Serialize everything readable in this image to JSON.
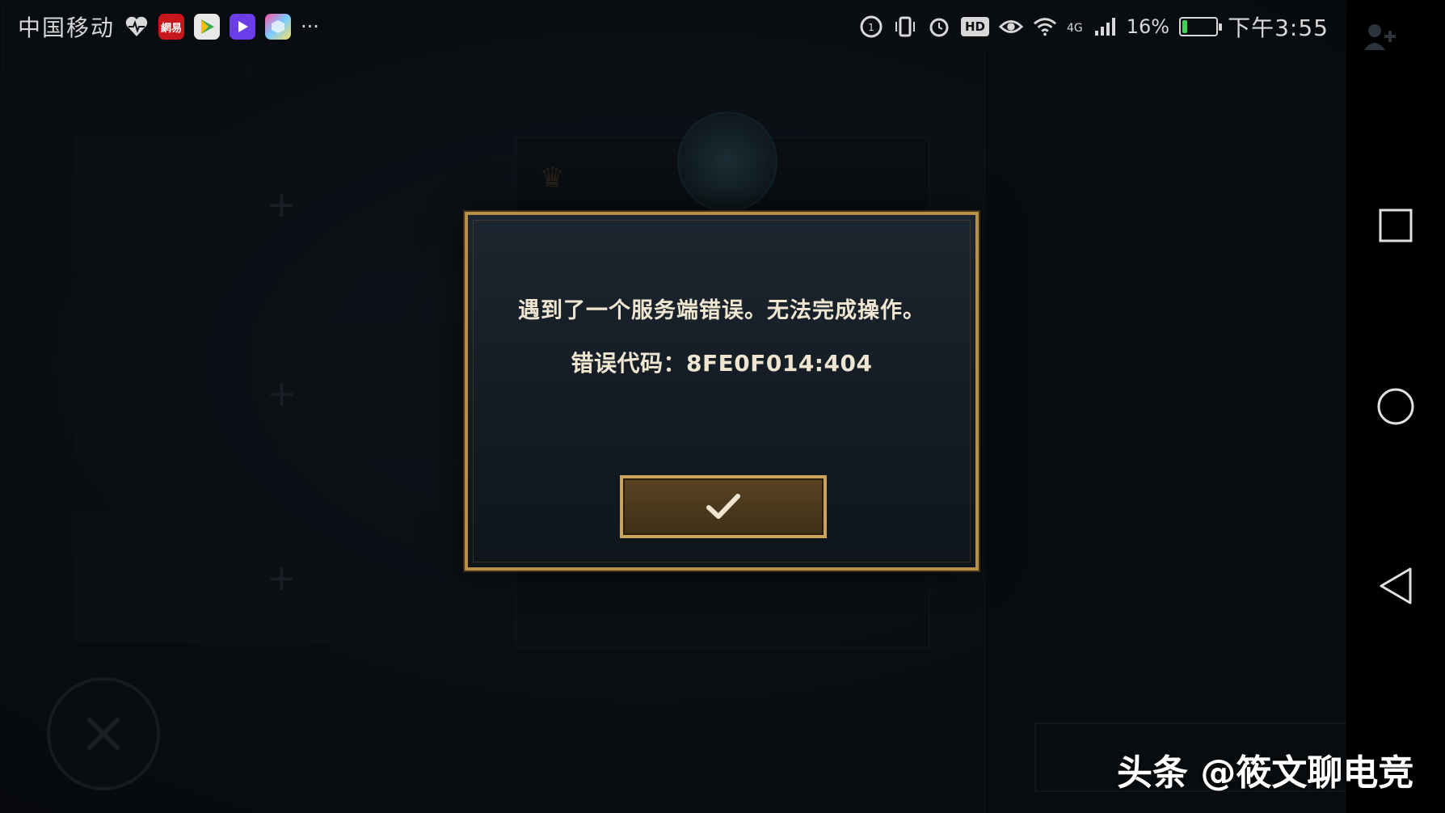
{
  "status_bar": {
    "carrier": "中国移动",
    "more": "···",
    "signal_label": "4G",
    "battery_percent": "16%",
    "battery_level": 0.16,
    "time": "下午3:55",
    "app_icons": [
      "heart-rate-icon",
      "netease-news-icon",
      "play-store-icon",
      "video-app-icon",
      "cube-app-icon"
    ],
    "netease_label": "網易"
  },
  "dialog": {
    "message": "遇到了一个服务端错误。无法完成操作。",
    "error_code": "错误代码：8FE0F014:404",
    "confirm_icon": "checkmark-icon"
  },
  "watermark": {
    "text": "头条 @筱文聊电竞"
  },
  "colors": {
    "gold_border": "#b8904a",
    "dialog_bg": "#141b23",
    "button_bg": "#4a3820",
    "battery_green": "#3ed15a"
  }
}
